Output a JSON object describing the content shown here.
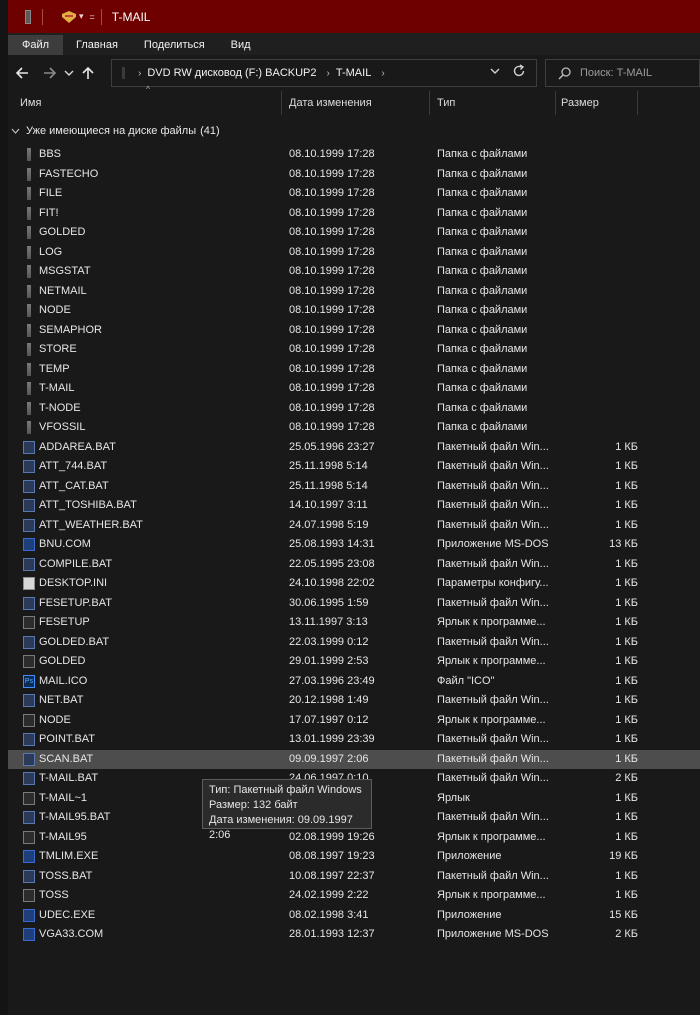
{
  "window": {
    "title": "T-MAIL",
    "qat_marker": "="
  },
  "menu": {
    "tabs": [
      {
        "label": "Файл",
        "active": true
      },
      {
        "label": "Главная",
        "active": false
      },
      {
        "label": "Поделиться",
        "active": false
      },
      {
        "label": "Вид",
        "active": false
      }
    ]
  },
  "address": {
    "crumbs": [
      "DVD RW дисковод (F:) BACKUP2",
      "T-MAIL"
    ]
  },
  "search": {
    "placeholder": "Поиск: T-MAIL"
  },
  "columns": {
    "name": "Имя",
    "date": "Дата изменения",
    "type": "Тип",
    "size": "Размер"
  },
  "group": {
    "label": "Уже имеющиеся на диске файлы",
    "count": "(41)"
  },
  "files": [
    {
      "name": "BBS",
      "date": "08.10.1999 17:28",
      "type": "Папка с файлами",
      "size": "",
      "icon": "folder"
    },
    {
      "name": "FASTECHO",
      "date": "08.10.1999 17:28",
      "type": "Папка с файлами",
      "size": "",
      "icon": "folder"
    },
    {
      "name": "FILE",
      "date": "08.10.1999 17:28",
      "type": "Папка с файлами",
      "size": "",
      "icon": "folder"
    },
    {
      "name": "FIT!",
      "date": "08.10.1999 17:28",
      "type": "Папка с файлами",
      "size": "",
      "icon": "folder"
    },
    {
      "name": "GOLDED",
      "date": "08.10.1999 17:28",
      "type": "Папка с файлами",
      "size": "",
      "icon": "folder"
    },
    {
      "name": "LOG",
      "date": "08.10.1999 17:28",
      "type": "Папка с файлами",
      "size": "",
      "icon": "folder"
    },
    {
      "name": "MSGSTAT",
      "date": "08.10.1999 17:28",
      "type": "Папка с файлами",
      "size": "",
      "icon": "folder"
    },
    {
      "name": "NETMAIL",
      "date": "08.10.1999 17:28",
      "type": "Папка с файлами",
      "size": "",
      "icon": "folder"
    },
    {
      "name": "NODE",
      "date": "08.10.1999 17:28",
      "type": "Папка с файлами",
      "size": "",
      "icon": "folder"
    },
    {
      "name": "SEMAPHOR",
      "date": "08.10.1999 17:28",
      "type": "Папка с файлами",
      "size": "",
      "icon": "folder"
    },
    {
      "name": "STORE",
      "date": "08.10.1999 17:28",
      "type": "Папка с файлами",
      "size": "",
      "icon": "folder"
    },
    {
      "name": "TEMP",
      "date": "08.10.1999 17:28",
      "type": "Папка с файлами",
      "size": "",
      "icon": "folder"
    },
    {
      "name": "T-MAIL",
      "date": "08.10.1999 17:28",
      "type": "Папка с файлами",
      "size": "",
      "icon": "folder"
    },
    {
      "name": "T-NODE",
      "date": "08.10.1999 17:28",
      "type": "Папка с файлами",
      "size": "",
      "icon": "folder"
    },
    {
      "name": "VFOSSIL",
      "date": "08.10.1999 17:28",
      "type": "Папка с файлами",
      "size": "",
      "icon": "folder"
    },
    {
      "name": "ADDAREA.BAT",
      "date": "25.05.1996 23:27",
      "type": "Пакетный файл Win...",
      "size": "1 КБ",
      "icon": "bat"
    },
    {
      "name": "ATT_744.BAT",
      "date": "25.11.1998 5:14",
      "type": "Пакетный файл Win...",
      "size": "1 КБ",
      "icon": "bat"
    },
    {
      "name": "ATT_CAT.BAT",
      "date": "25.11.1998 5:14",
      "type": "Пакетный файл Win...",
      "size": "1 КБ",
      "icon": "bat"
    },
    {
      "name": "ATT_TOSHIBA.BAT",
      "date": "14.10.1997 3:11",
      "type": "Пакетный файл Win...",
      "size": "1 КБ",
      "icon": "bat"
    },
    {
      "name": "ATT_WEATHER.BAT",
      "date": "24.07.1998 5:19",
      "type": "Пакетный файл Win...",
      "size": "1 КБ",
      "icon": "bat"
    },
    {
      "name": "BNU.COM",
      "date": "25.08.1993 14:31",
      "type": "Приложение MS-DOS",
      "size": "13 КБ",
      "icon": "com"
    },
    {
      "name": "COMPILE.BAT",
      "date": "22.05.1995 23:08",
      "type": "Пакетный файл Win...",
      "size": "1 КБ",
      "icon": "bat"
    },
    {
      "name": "DESKTOP.INI",
      "date": "24.10.1998 22:02",
      "type": "Параметры конфигу...",
      "size": "1 КБ",
      "icon": "ini"
    },
    {
      "name": "FESETUP.BAT",
      "date": "30.06.1995 1:59",
      "type": "Пакетный файл Win...",
      "size": "1 КБ",
      "icon": "bat"
    },
    {
      "name": "FESETUP",
      "date": "13.11.1997 3:13",
      "type": "Ярлык к программе...",
      "size": "1 КБ",
      "icon": "lnk"
    },
    {
      "name": "GOLDED.BAT",
      "date": "22.03.1999 0:12",
      "type": "Пакетный файл Win...",
      "size": "1 КБ",
      "icon": "bat"
    },
    {
      "name": "GOLDED",
      "date": "29.01.1999 2:53",
      "type": "Ярлык к программе...",
      "size": "1 КБ",
      "icon": "lnk"
    },
    {
      "name": "MAIL.ICO",
      "date": "27.03.1996 23:49",
      "type": "Файл \"ICO\"",
      "size": "1 КБ",
      "icon": "ico"
    },
    {
      "name": "NET.BAT",
      "date": "20.12.1998 1:49",
      "type": "Пакетный файл Win...",
      "size": "1 КБ",
      "icon": "bat"
    },
    {
      "name": "NODE",
      "date": "17.07.1997 0:12",
      "type": "Ярлык к программе...",
      "size": "1 КБ",
      "icon": "lnk"
    },
    {
      "name": "POINT.BAT",
      "date": "13.01.1999 23:39",
      "type": "Пакетный файл Win...",
      "size": "1 КБ",
      "icon": "bat"
    },
    {
      "name": "SCAN.BAT",
      "date": "09.09.1997 2:06",
      "type": "Пакетный файл Win...",
      "size": "1 КБ",
      "icon": "bat",
      "selected": true
    },
    {
      "name": "T-MAIL.BAT",
      "date": "24.06.1997 0:10",
      "type": "Пакетный файл Win...",
      "size": "2 КБ",
      "icon": "bat"
    },
    {
      "name": "T-MAIL~1",
      "date": "",
      "type": "Ярлык",
      "size": "1 КБ",
      "icon": "lnk"
    },
    {
      "name": "T-MAIL95.BAT",
      "date": "",
      "type": "Пакетный файл Win...",
      "size": "1 КБ",
      "icon": "bat"
    },
    {
      "name": "T-MAIL95",
      "date": "02.08.1999 19:26",
      "type": "Ярлык к программе...",
      "size": "1 КБ",
      "icon": "lnk"
    },
    {
      "name": "TMLIM.EXE",
      "date": "08.08.1997 19:23",
      "type": "Приложение",
      "size": "19 КБ",
      "icon": "exe"
    },
    {
      "name": "TOSS.BAT",
      "date": "10.08.1997 22:37",
      "type": "Пакетный файл Win...",
      "size": "1 КБ",
      "icon": "bat"
    },
    {
      "name": "TOSS",
      "date": "24.02.1999 2:22",
      "type": "Ярлык к программе...",
      "size": "1 КБ",
      "icon": "lnk"
    },
    {
      "name": "UDEC.EXE",
      "date": "08.02.1998 3:41",
      "type": "Приложение",
      "size": "15 КБ",
      "icon": "exe"
    },
    {
      "name": "VGA33.COM",
      "date": "28.01.1993 12:37",
      "type": "Приложение MS-DOS",
      "size": "2 КБ",
      "icon": "com"
    }
  ],
  "tooltip": {
    "type_line": "Тип: Пакетный файл Windows",
    "size_line": "Размер: 132 байт",
    "date_line": "Дата изменения: 09.09.1997 2:06"
  },
  "colors": {
    "titlebar": "#6e0000",
    "background": "#191919",
    "selected_row": "#4d4d4d"
  }
}
